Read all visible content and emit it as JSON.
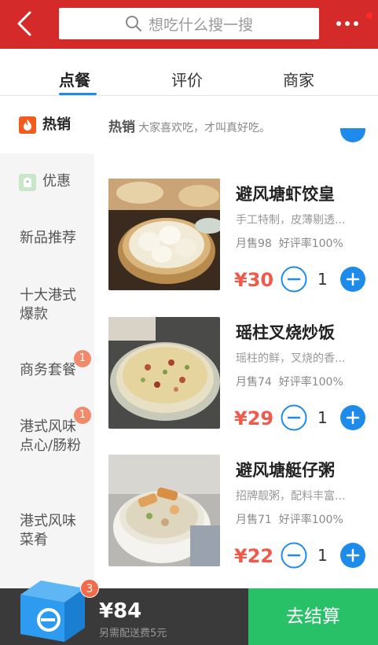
{
  "header": {
    "search_placeholder": "想吃什么搜一搜"
  },
  "tabs": [
    {
      "label": "点餐",
      "active": true
    },
    {
      "label": "评价",
      "active": false
    },
    {
      "label": "商家",
      "active": false
    }
  ],
  "sidebar": {
    "items": [
      {
        "label": "热销",
        "icon": "flame-icon",
        "active": true
      },
      {
        "label": "优惠",
        "icon": "coupon-icon"
      },
      {
        "label": "新品推荐"
      },
      {
        "label": "十大港式爆款"
      },
      {
        "label": "商务套餐",
        "badge": "1"
      },
      {
        "label": "港式风味点心/肠粉",
        "badge": "1"
      },
      {
        "label": "港式风味菜肴"
      }
    ]
  },
  "section": {
    "title": "热销",
    "subtitle": "大家喜欢吃，才叫真好吃。"
  },
  "items": [
    {
      "name": "避风塘虾饺皇",
      "desc": "手工特制，皮薄剔透...",
      "sales": "月售98",
      "rating": "好评率100%",
      "price": "¥30",
      "qty": "1"
    },
    {
      "name": "瑶柱叉烧炒饭",
      "desc": "瑶柱的鲜，叉烧的香...",
      "sales": "月售74",
      "rating": "好评率100%",
      "price": "¥29",
      "qty": "1"
    },
    {
      "name": "避风塘艇仔粥",
      "desc": "招牌靓粥，配料丰富...",
      "sales": "月售71",
      "rating": "好评率100%",
      "price": "¥22",
      "qty": "1"
    }
  ],
  "cart": {
    "badge": "3",
    "total": "¥84",
    "delivery_note": "另需配送费5元",
    "checkout_label": "去结算"
  },
  "colors": {
    "header": "#d42a2a",
    "accent_blue": "#1e8bea",
    "price_red": "#f05a4a",
    "checkout_green": "#28c168"
  }
}
